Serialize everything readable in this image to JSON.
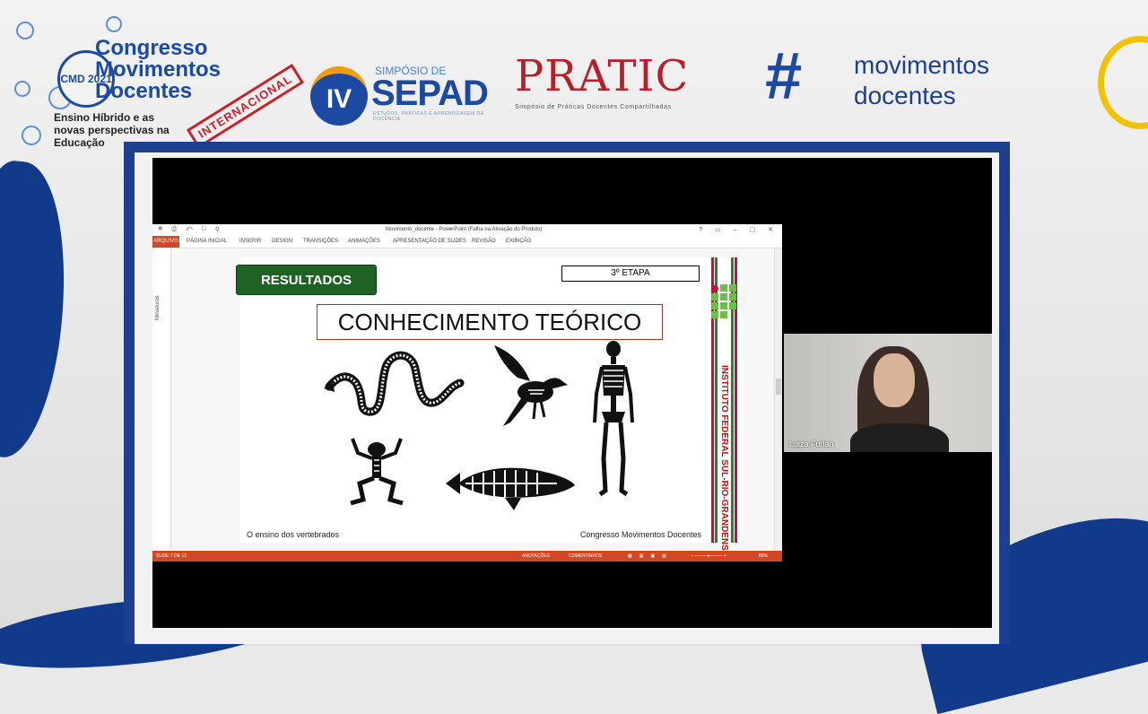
{
  "header": {
    "cmd": {
      "badge_text": "CMD 2021",
      "title": "Congresso Movimentos Docentes",
      "subtitle": "Ensino Híbrido e as novas perspectivas na Educação",
      "stamp": "INTERNACIONAL"
    },
    "sepad": {
      "numeral": "IV",
      "small_text": "SIMPÓSIO DE",
      "name": "SEPAD",
      "tagline": "ESTUDOS, PRÁTICAS E APRENDIZAGEM DA DOCÊNCIA"
    },
    "pratic": {
      "name": "PRATIC",
      "subtitle": "Simpósio de Práticas Docentes Compartilhadas"
    },
    "movimentos": {
      "hash": "#",
      "name_line1": "movimentos",
      "name_line2": "docentes"
    }
  },
  "powerpoint": {
    "window_title": "Movimento_docente - PowerPoint (Falha na Ativação do Produto)",
    "quick_access": "⛯ ⎙ ↶ ↻ ⚲",
    "window_controls": "? ▭ – ▢ ✕",
    "file_tab": "ARQUIVO",
    "tabs": [
      "PÁGINA INICIAL",
      "INSERIR",
      "DESIGN",
      "TRANSIÇÕES",
      "ANIMAÇÕES",
      "APRESENTAÇÃO DE SLIDES",
      "REVISÃO",
      "EXIBIÇÃO"
    ],
    "side_panel_label": "Miniaturas",
    "status": {
      "slide_counter": "SLIDE 7 DE 13",
      "notes": "ANOTAÇÕES",
      "comments": "COMENTÁRIOS",
      "zoom": "89%"
    }
  },
  "slide": {
    "section_button": "RESULTADOS",
    "stage_label": "3º ETAPA",
    "heading": "CONHECIMENTO TEÓRICO",
    "images": [
      "snake-skeleton",
      "bird-skeleton",
      "human-skeleton",
      "frog-skeleton",
      "fish-skeleton"
    ],
    "footer_left": "O ensino dos vertebrados",
    "footer_right": "Congresso Movimentos Docentes",
    "institute_text": "INSTITUTO FEDERAL SUL-RIO-GRANDENSE"
  },
  "webcam": {
    "participant_name": "Luiza Furlan"
  },
  "colors": {
    "brand_blue": "#1c3f8f",
    "ppt_accent": "#d24726",
    "result_green": "#1e6324",
    "pratic_red": "#b5202a",
    "if_green": "#6cbf45"
  }
}
